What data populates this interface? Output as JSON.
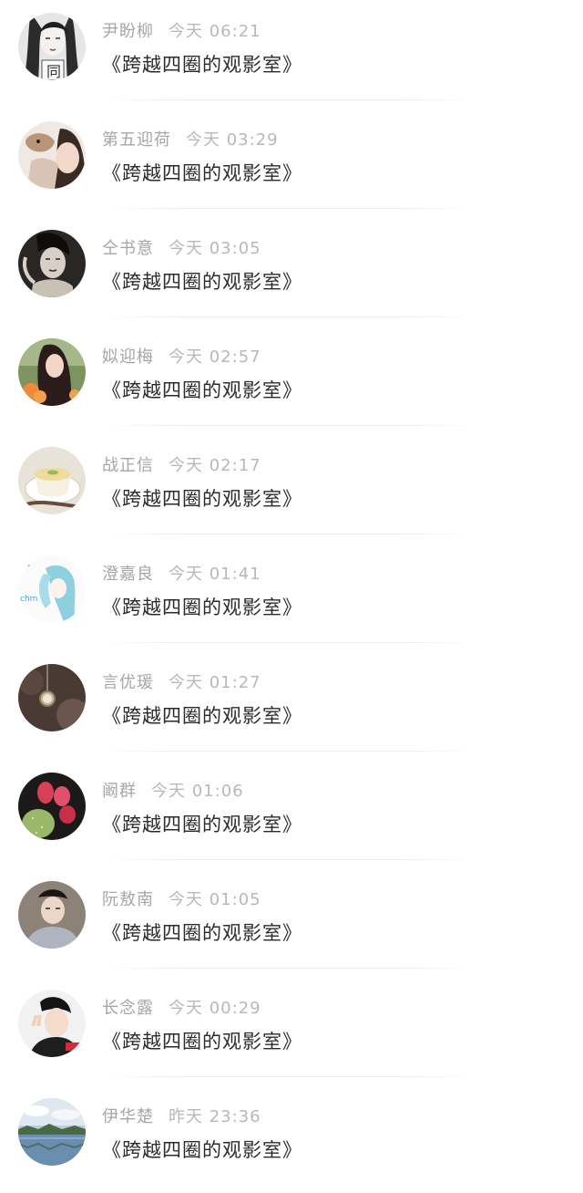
{
  "comments": [
    {
      "name": "尹盼柳",
      "time": "今天 06:21",
      "message": "《跨越四圈的观影室》",
      "avatar": "avatar-illustrated-woman"
    },
    {
      "name": "第五迎荷",
      "time": "今天 03:29",
      "message": "《跨越四圈的观影室》",
      "avatar": "avatar-girl-with-puppy"
    },
    {
      "name": "仝书意",
      "time": "今天 03:05",
      "message": "《跨越四圈的观影室》",
      "avatar": "avatar-vintage-woman"
    },
    {
      "name": "姒迎梅",
      "time": "今天 02:57",
      "message": "《跨越四圈的观影室》",
      "avatar": "avatar-girl-flowers"
    },
    {
      "name": "战正信",
      "time": "今天 02:17",
      "message": "《跨越四圈的观影室》",
      "avatar": "avatar-pudding-bowl"
    },
    {
      "name": "澄嘉良",
      "time": "今天 01:41",
      "message": "《跨越四圈的观影室》",
      "avatar": "avatar-anime-blue-hair"
    },
    {
      "name": "言优瑗",
      "time": "今天 01:27",
      "message": "《跨越四圈的观影室》",
      "avatar": "avatar-pocket-watch"
    },
    {
      "name": "阚群",
      "time": "今天 01:06",
      "message": "《跨越四圈的观影室》",
      "avatar": "avatar-cactus-fruit"
    },
    {
      "name": "阮敖南",
      "time": "今天 01:05",
      "message": "《跨越四圈的观影室》",
      "avatar": "avatar-young-man"
    },
    {
      "name": "长念露",
      "time": "今天 00:29",
      "message": "《跨越四圈的观影室》",
      "avatar": "avatar-boy-peace-sign"
    },
    {
      "name": "伊华楚",
      "time": "昨天 23:36",
      "message": "《跨越四圈的观影室》",
      "avatar": "avatar-lake-landscape"
    }
  ]
}
